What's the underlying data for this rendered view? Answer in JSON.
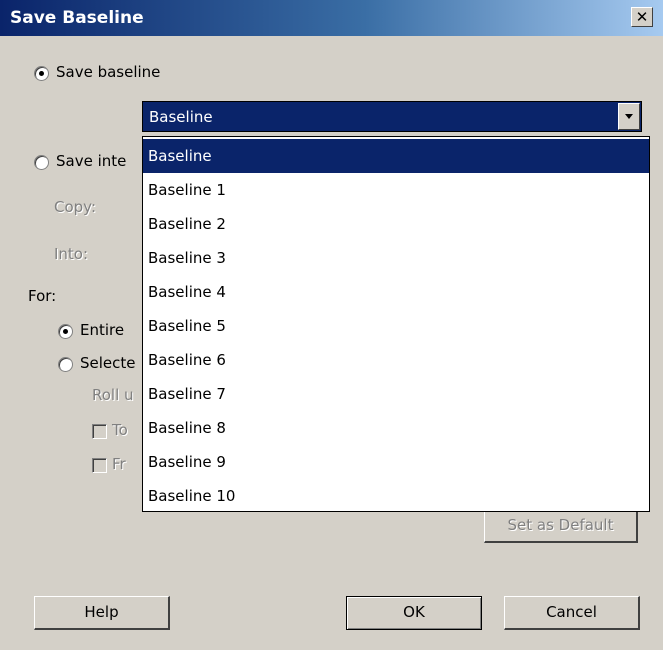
{
  "dialog": {
    "title": "Save Baseline"
  },
  "options": {
    "save_baseline": "Save baseline",
    "save_interim": "Save inte",
    "copy_label": "Copy:",
    "into_label": "Into:",
    "for_label": "For:",
    "entire_project": "Entire",
    "selected_tasks": "Selecte",
    "roll_up": "Roll u",
    "to_all": "To",
    "from_subtasks": "Fr"
  },
  "baseline_select": {
    "selected": "Baseline",
    "options": [
      "Baseline",
      "Baseline 1",
      "Baseline 2",
      "Baseline 3",
      "Baseline 4",
      "Baseline 5",
      "Baseline 6",
      "Baseline 7",
      "Baseline 8",
      "Baseline 9",
      "Baseline 10"
    ]
  },
  "buttons": {
    "set_default": "Set as Default",
    "help": "Help",
    "ok": "OK",
    "cancel": "Cancel"
  }
}
